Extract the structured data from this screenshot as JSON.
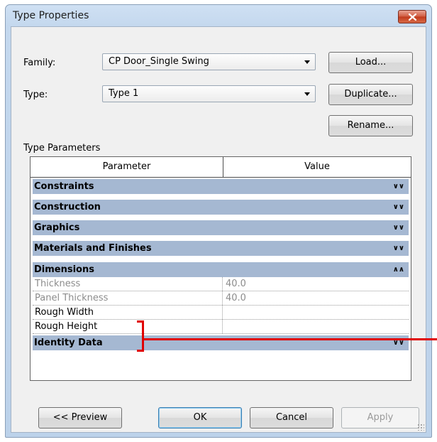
{
  "window": {
    "title": "Type Properties"
  },
  "family": {
    "label": "Family:",
    "value": "CP Door_Single Swing"
  },
  "type": {
    "label": "Type:",
    "value": "Type 1"
  },
  "buttons": {
    "load": "Load...",
    "duplicate": "Duplicate...",
    "rename": "Rename...",
    "preview": "<< Preview",
    "ok": "OK",
    "cancel": "Cancel",
    "apply": "Apply"
  },
  "type_parameters": {
    "heading": "Type Parameters",
    "columns": {
      "parameter": "Parameter",
      "value": "Value"
    },
    "groups": [
      {
        "name": "Constraints",
        "state": "collapsed"
      },
      {
        "name": "Construction",
        "state": "collapsed"
      },
      {
        "name": "Graphics",
        "state": "collapsed"
      },
      {
        "name": "Materials and Finishes",
        "state": "collapsed"
      },
      {
        "name": "Dimensions",
        "state": "expanded"
      },
      {
        "name": "Identity Data",
        "state": "collapsed"
      }
    ],
    "rows": [
      {
        "name": "Thickness",
        "value": "40.0",
        "greyed": true
      },
      {
        "name": "Panel Thickness",
        "value": "40.0",
        "greyed": true
      },
      {
        "name": "Rough Width",
        "value": "",
        "greyed": false
      },
      {
        "name": "Rough Height",
        "value": "",
        "greyed": false
      }
    ]
  },
  "colors": {
    "group_row": "#a5b8d2",
    "annotation": "#e00000",
    "title_bar": "#cfe0f3"
  },
  "icons": {
    "close": "close-icon",
    "collapsed": "double-chevron-down-icon",
    "expanded": "double-chevron-up-icon"
  }
}
